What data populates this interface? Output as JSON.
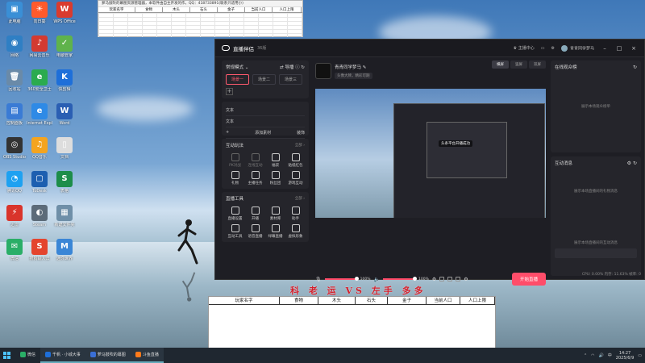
{
  "desktop": {
    "icons": [
      {
        "label": "此电脑",
        "color": "#3a8fd6",
        "glyph": "▣"
      },
      {
        "label": "网络",
        "color": "#2f7fc4",
        "glyph": "◉"
      },
      {
        "label": "回收站",
        "color": "#6a8aa8",
        "glyph": "🗑"
      },
      {
        "label": "控制面板",
        "color": "#3a7bd5",
        "glyph": "▤"
      },
      {
        "label": "OBS Studio",
        "color": "#333333",
        "glyph": "◎"
      },
      {
        "label": "腾讯QQ",
        "color": "#1ea1f1",
        "glyph": "◔"
      },
      {
        "label": "迅雷",
        "color": "#d9342b",
        "glyph": "⚡"
      },
      {
        "label": "微信",
        "color": "#2aae67",
        "glyph": "✉"
      },
      {
        "label": "向日葵",
        "color": "#ff5a2c",
        "glyph": "☀"
      },
      {
        "label": "网易云音乐",
        "color": "#d33a31",
        "glyph": "♪"
      },
      {
        "label": "360安全卫士",
        "color": "#2bab4f",
        "glyph": "e"
      },
      {
        "label": "Internet Explorer",
        "color": "#2e8ae6",
        "glyph": "e"
      },
      {
        "label": "QQ音乐",
        "color": "#f4a41f",
        "glyph": "♫"
      },
      {
        "label": "ToDesk",
        "color": "#1d5fb0",
        "glyph": "▢"
      },
      {
        "label": "Steam",
        "color": "#5c6b79",
        "glyph": "◐"
      },
      {
        "label": "搜狗输入法",
        "color": "#e4442e",
        "glyph": "S"
      },
      {
        "label": "WPS Office",
        "color": "#d93b2e",
        "glyph": "W"
      },
      {
        "label": "电脑管家",
        "color": "#5fb34b",
        "glyph": "✓"
      },
      {
        "label": "快剪辑",
        "color": "#1e6fd9",
        "glyph": "K"
      },
      {
        "label": "Word",
        "color": "#2b5fb3",
        "glyph": "W"
      },
      {
        "label": "文档",
        "color": "#dddddd",
        "glyph": "▯"
      },
      {
        "label": "表格",
        "color": "#1d8d4a",
        "glyph": "S"
      },
      {
        "label": "新建文件夹",
        "color": "#6f8fa8",
        "glyph": "▦"
      },
      {
        "label": "迷你世界",
        "color": "#3a86d6",
        "glyph": "M"
      }
    ]
  },
  "excel_top": {
    "title": "萝马鼓吹的幕图资源管理器，本软件由自主开发的作，QQ：418733891(联系只适用小)",
    "columns": [
      "玩家名字",
      "食物",
      "木头",
      "石头",
      "金子",
      "当前人口",
      "人口上限"
    ]
  },
  "app": {
    "name": "直播伴侣",
    "version": "36版",
    "top_right": {
      "creator_center": "主播中心",
      "user": "青青同学梦马"
    },
    "mode": {
      "label": "常规模式",
      "guide": "导播"
    },
    "scenes": [
      "场景一",
      "场景二",
      "场景三"
    ],
    "sources": [
      {
        "label": "文本"
      },
      {
        "label": "文本"
      },
      {
        "label": "添加素材",
        "extra": "装饰"
      }
    ],
    "interactive": {
      "title": "互动玩法",
      "all": "全部 ›",
      "tools": [
        "PK对战",
        "连线互动",
        "福袋",
        "贴纸红包",
        "礼物",
        "主播任务",
        "粉丝团",
        "游戏互动"
      ]
    },
    "live_tools": {
      "title": "直播工具",
      "all": "全部 ›",
      "tools": [
        "直播设置",
        "开播",
        "素材库",
        "助手",
        "互动工具",
        "语音直播",
        "绿幕直播",
        "虚拟形象"
      ]
    },
    "room": {
      "title": "青青同学梦马",
      "tag": "头像大牌，精彩可期"
    },
    "view_tabs": [
      "横屏",
      "竖屏",
      "双屏"
    ],
    "preview_toast": "头条平台开播成功",
    "audio": {
      "mic_pct": "100%",
      "speaker_pct": "100%"
    },
    "start_button": "开始直播",
    "status": "CPU: 0.00%   内存: 11.63%   帧率: 0",
    "audience": {
      "title": "在线观众榜",
      "hint": "展示本场观众榜单"
    },
    "chat": {
      "title": "互动消息",
      "hint1": "展示本场直播间的礼物消息",
      "hint2": "展示本场直播间的互动消息"
    }
  },
  "deco_title": "科 老 运 VS 左手 多多",
  "excel_bottom": {
    "columns": [
      "玩家名字",
      "食物",
      "木头",
      "石头",
      "金子",
      "当前人口",
      "人口上限"
    ]
  },
  "taskbar": {
    "items": [
      {
        "label": "微信",
        "color": "#2aae67",
        "open": false
      },
      {
        "label": "千帆 · 小城大事",
        "color": "#1e6fd9",
        "open": true
      },
      {
        "label": "萝马鼓吹的幕图",
        "color": "#3a6fd6",
        "open": true
      },
      {
        "label": "斗鱼直播",
        "color": "#ff7a1a",
        "open": true
      }
    ],
    "time": "14:27",
    "date": "2025/6/9",
    "lang": "中"
  }
}
